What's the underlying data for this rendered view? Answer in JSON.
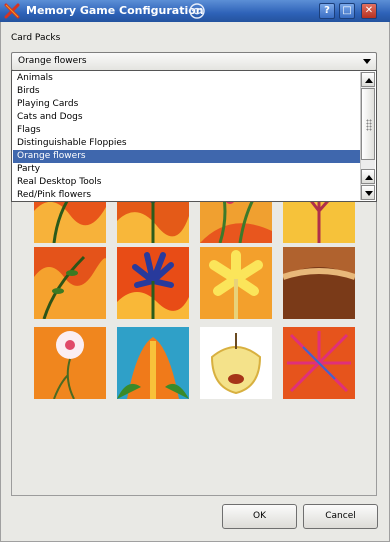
{
  "window": {
    "title": "Memory Game Configuration",
    "help_label": "?",
    "maximize_label": "□",
    "close_label": "✕"
  },
  "card_packs": {
    "group_label": "Card Packs",
    "selected": "Orange flowers",
    "options": [
      "Animals",
      "Birds",
      "Playing Cards",
      "Cats and Dogs",
      "Flags",
      "Distinguishable Floppies",
      "Orange flowers",
      "Party",
      "Real Desktop Tools",
      "Red/Pink flowers"
    ]
  },
  "preview": {
    "tiles": [
      "flames-leaves",
      "blue-flower-flames",
      "green-pink-stems",
      "pink-stem-yellow",
      "flames-vine",
      "blue-lily",
      "yellow-flower",
      "mushroom-gills",
      "white-pink-flower",
      "calla-lily",
      "apple-slice",
      "pink-spiky-flower"
    ]
  },
  "buttons": {
    "ok": "OK",
    "cancel": "Cancel"
  },
  "colors": {
    "titlebar": "#2e62b8",
    "selection": "#3f67ad",
    "window_bg": "#e9e9e5"
  },
  "icons": {
    "app": "x-app-icon",
    "swirl": "swirl-icon"
  }
}
